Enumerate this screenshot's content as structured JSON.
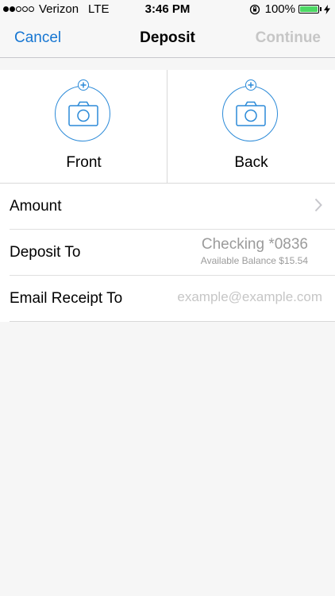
{
  "status_bar": {
    "carrier": "Verizon",
    "network": "LTE",
    "time": "3:46 PM",
    "battery_percent": "100%",
    "battery_level": 1.0,
    "signal_bars_filled": 2,
    "signal_bars_total": 5
  },
  "nav": {
    "cancel_label": "Cancel",
    "title": "Deposit",
    "continue_label": "Continue"
  },
  "photos": {
    "front_label": "Front",
    "back_label": "Back"
  },
  "form": {
    "amount_label": "Amount",
    "deposit_to_label": "Deposit To",
    "deposit_account": "Checking *0836",
    "available_balance": "Available Balance $15.54",
    "email_label": "Email Receipt To",
    "email_placeholder": "example@example.com"
  },
  "colors": {
    "accent": "#1676d2",
    "camera_icon": "#2b8ad8",
    "disabled": "#c6c6c6",
    "battery_fill": "#4cd964"
  }
}
